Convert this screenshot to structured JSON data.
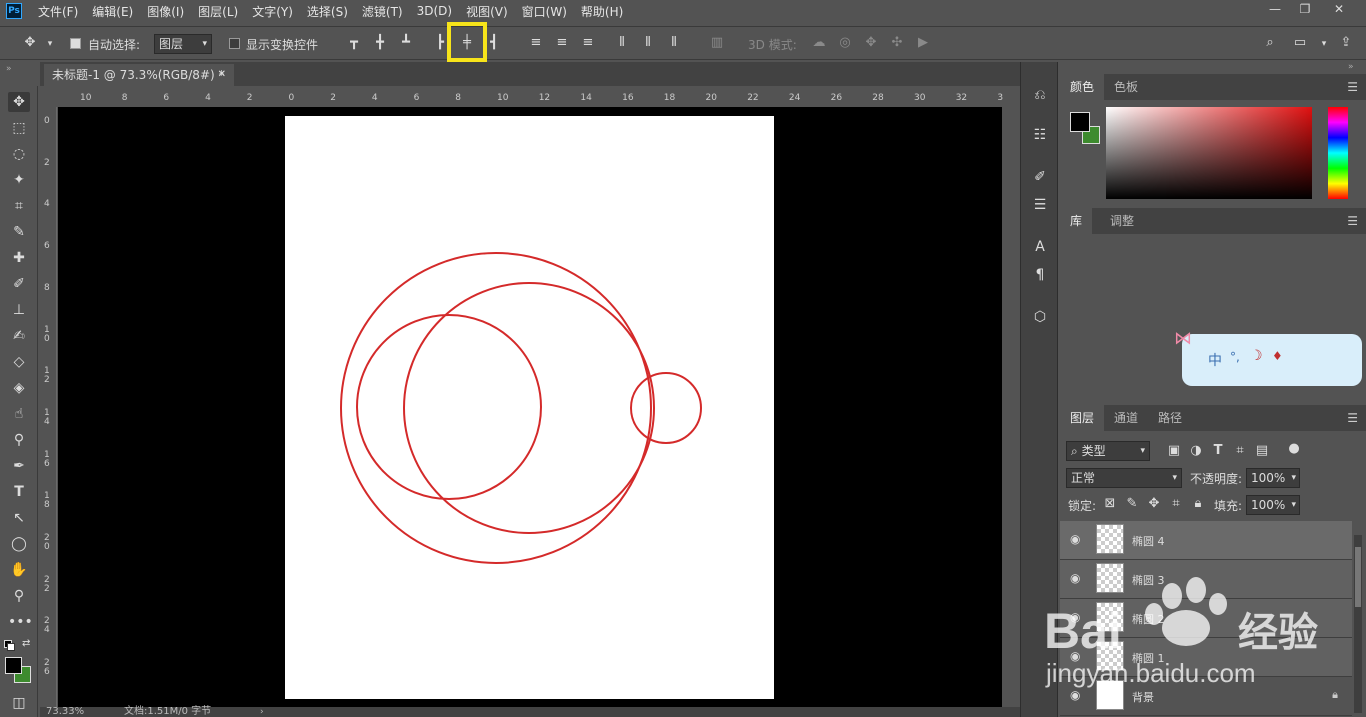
{
  "app": {
    "logo": "Ps"
  },
  "menu": [
    "文件(F)",
    "编辑(E)",
    "图像(I)",
    "图层(L)",
    "文字(Y)",
    "选择(S)",
    "滤镜(T)",
    "3D(D)",
    "视图(V)",
    "窗口(W)",
    "帮助(H)"
  ],
  "window_controls": {
    "minimize": "—",
    "restore": "❐",
    "close": "✕"
  },
  "options": {
    "auto_select_label": "自动选择:",
    "auto_select_value": "图层",
    "show_transform_label": "显示变换控件",
    "mode_3d_label": "3D 模式:"
  },
  "document": {
    "tab_title": "未标题-1 @ 73.3%(RGB/8#) *",
    "tab_close": "✕"
  },
  "ruler": {
    "h_labels": [
      "10",
      "8",
      "6",
      "4",
      "2",
      "0",
      "2",
      "4",
      "6",
      "8",
      "10",
      "12",
      "14",
      "16",
      "18",
      "20",
      "22",
      "24",
      "26",
      "28",
      "30",
      "32",
      "3"
    ],
    "v_labels": [
      "0",
      "2",
      "4",
      "6",
      "8",
      "1 0",
      "1 2",
      "1 4",
      "1 6",
      "1 8",
      "2 0",
      "2 2",
      "2 4",
      "2 6"
    ]
  },
  "status": {
    "zoom": "73.33%",
    "doc_info": "文档:1.51M/0 字节"
  },
  "color_panel": {
    "tabs": [
      "颜色",
      "色板"
    ]
  },
  "library_panel": {
    "tabs": [
      "库",
      "调整"
    ]
  },
  "layers_panel": {
    "tabs": [
      "图层",
      "通道",
      "路径"
    ],
    "filter_kind": "类型",
    "blend_mode": "正常",
    "opacity_label": "不透明度:",
    "opacity_value": "100%",
    "lock_label": "锁定:",
    "fill_label": "填充:",
    "fill_value": "100%",
    "layers": [
      {
        "name": "椭圆 4"
      },
      {
        "name": "椭圆 3"
      },
      {
        "name": "椭圆 2"
      },
      {
        "name": "椭圆 1"
      },
      {
        "name": "背景"
      }
    ]
  },
  "ime_widget": {
    "label": "中"
  },
  "watermark": {
    "brand": "Bai",
    "brand_tail": "经验",
    "url": "jingyan.baidu.com"
  },
  "colors": {
    "circle_stroke": "#d42a2a",
    "highlight": "#f7e41a",
    "foreground": "#000000",
    "background": "#3d8b2e"
  }
}
